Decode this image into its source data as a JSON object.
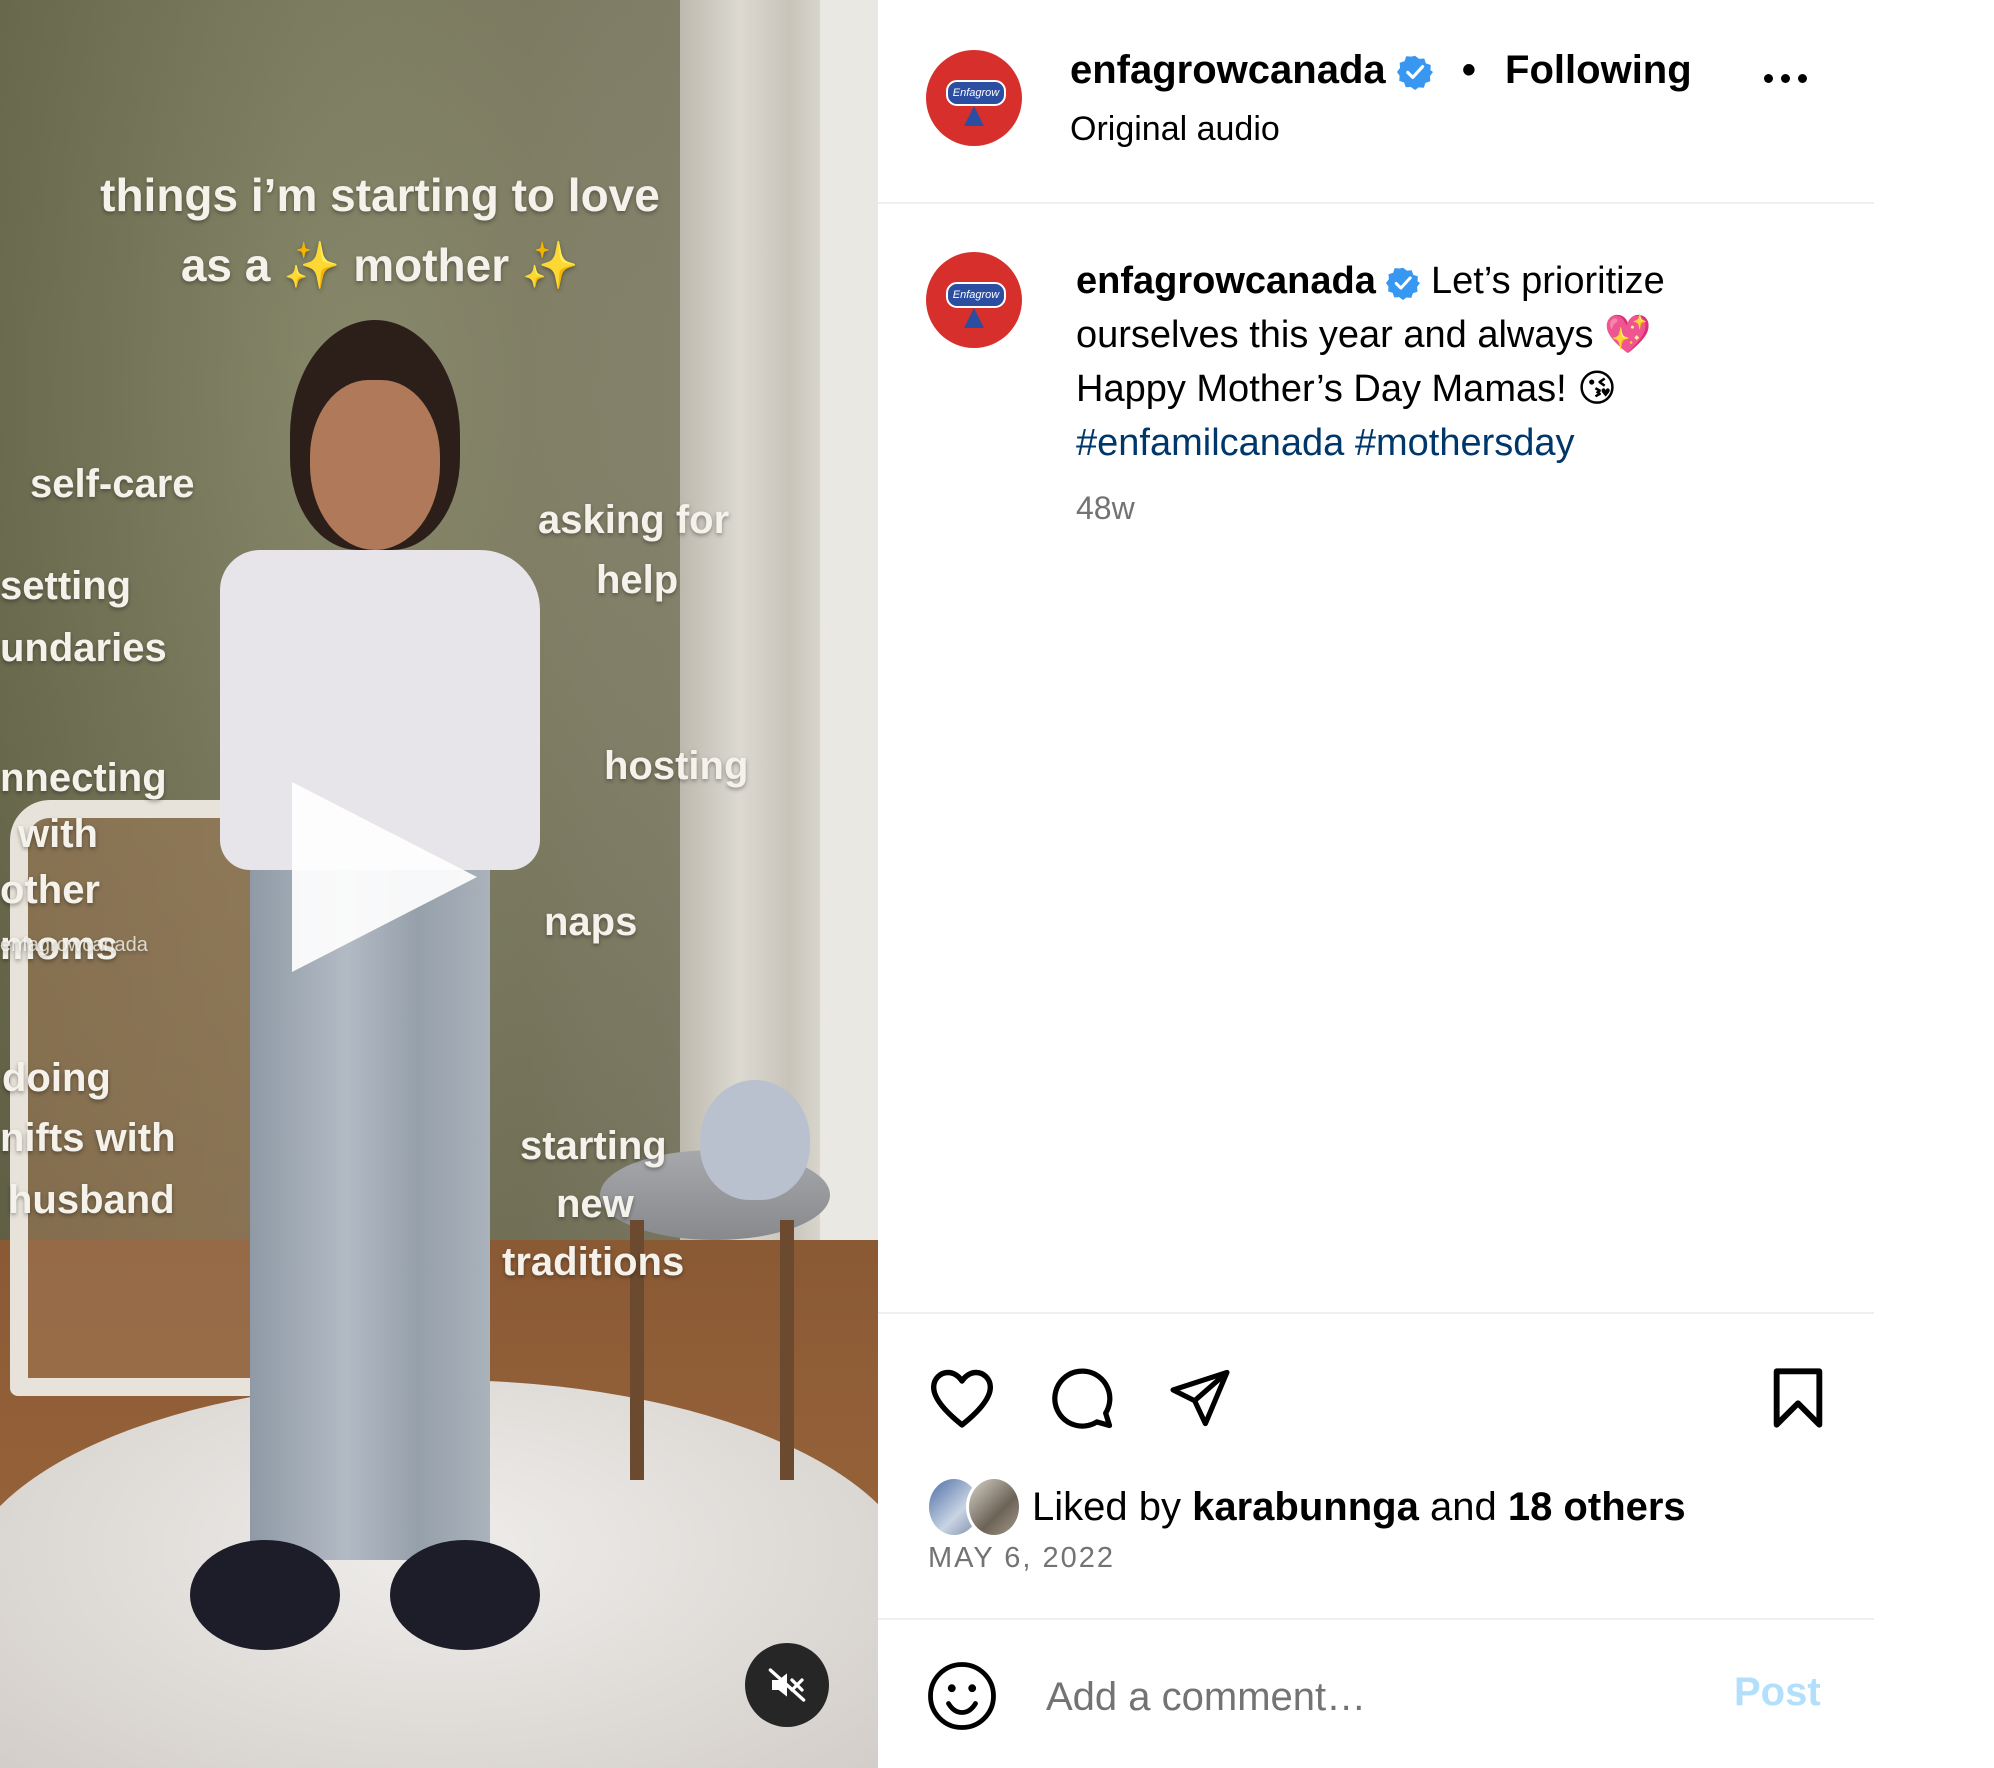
{
  "video": {
    "title_line1": "things i’m starting to love",
    "title_line2": "as a ✨ mother ✨",
    "overlay_items": [
      "self-care",
      "setting",
      "undaries",
      "asking for",
      "help",
      "nnecting",
      "with",
      "other",
      "moms",
      "hosting",
      "naps",
      "doing",
      "nifts with",
      "husband",
      "starting",
      "new",
      "traditions"
    ],
    "watermark": "enfagrowcanada",
    "play_icon": "play-icon",
    "mute_icon": "speaker-muted-icon"
  },
  "header": {
    "username": "enfagrowcanada",
    "verified_icon": "verified-badge-icon",
    "separator": "•",
    "follow_status": "Following",
    "audio": "Original audio",
    "avatar_logo": "Enfagrow",
    "more_icon": "more-options-icon"
  },
  "caption": {
    "username": "enfagrowcanada",
    "text_line1": "Let’s prioritize",
    "text_line2": "ourselves this year and always 💖",
    "text_line3": "Happy Mother’s Day Mamas! 😘",
    "hashtag1": "#enfamilcanada",
    "hashtag2": "#mothersday",
    "age": "48w"
  },
  "actions": {
    "like_icon": "heart-icon",
    "comment_icon": "comment-icon",
    "share_icon": "send-icon",
    "save_icon": "bookmark-icon"
  },
  "likes": {
    "prefix": "Liked by",
    "liker": "karabunnga",
    "conjunction": "and",
    "others": "18 others"
  },
  "date": "MAY 6, 2022",
  "comment": {
    "emoji_icon": "smiley-icon",
    "placeholder": "Add a comment…",
    "post_label": "Post"
  },
  "colors": {
    "verified": "#3897f0",
    "hashtag": "#00376b",
    "post_disabled": "#b2dffc",
    "avatar_bg": "#d7302c"
  }
}
